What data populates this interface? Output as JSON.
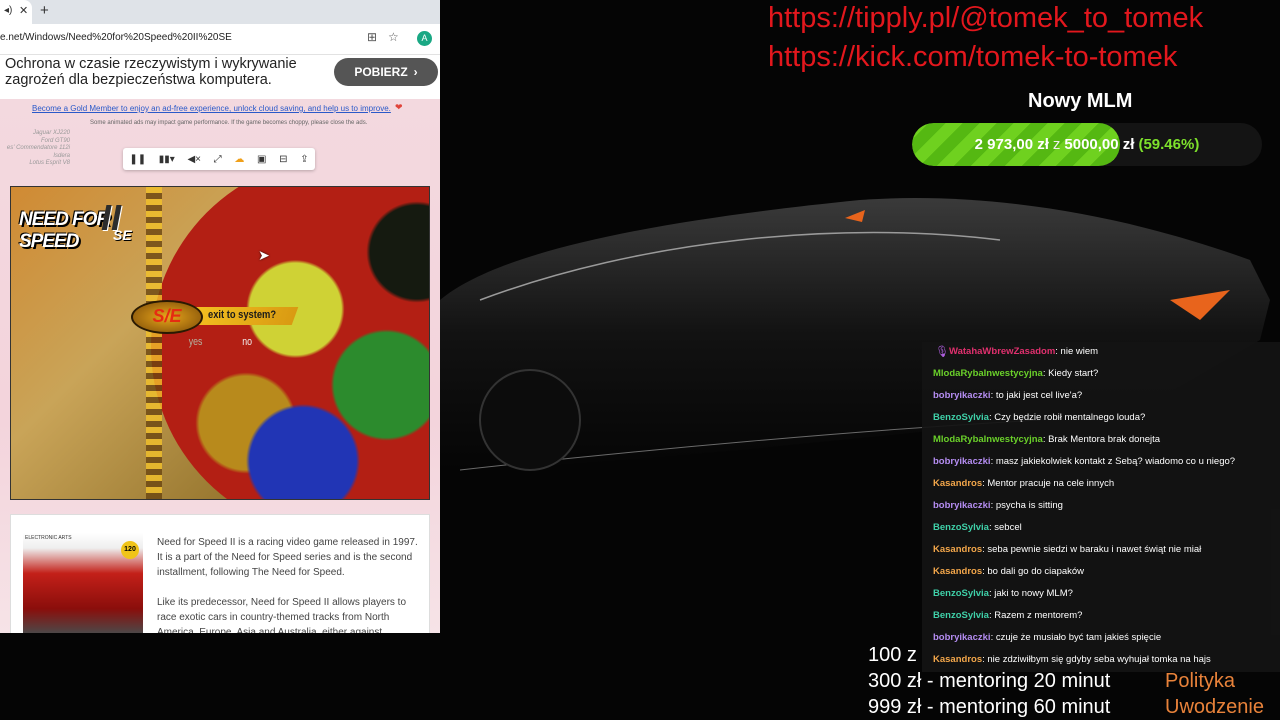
{
  "browser": {
    "url": "e.net/Windows/Need%20for%20Speed%20II%20SE",
    "account_initial": "A",
    "ad": {
      "text": "Ochrona w czasie rzeczywistym i wykrywanie zagrożeń dla bezpieczeństwa komputera.",
      "button": "POBIERZ"
    },
    "gold_link": "Become a Gold Member to enjoy an ad-free experience, unlock cloud saving, and help us to improve.",
    "perf_note": "Some animated ads may impact game performance. If the game becomes choppy, please close the ads.",
    "side_list": [
      "Jaguar XJ220",
      "Ford GT90",
      "es' Commendatore 112i",
      "Isdera",
      "Lotus Esprit V8"
    ],
    "game": {
      "logo_text": "NEED FOR SPEED",
      "logo_numeral": "II",
      "logo_suffix": "SE",
      "badge": "S/E",
      "prompt": "exit to system?",
      "option_yes": "yes",
      "option_no": "no"
    },
    "info": {
      "cover_publisher": "ELECTRONIC ARTS",
      "cover_badge": "120",
      "paragraph1": "Need for Speed II is a racing video game released in 1997. It is a part of the Need for Speed series and is the second installment, following The Need for Speed.",
      "paragraph2": "Like its predecessor, Need for Speed II allows players to race exotic cars in country-themed tracks from North America, Europe, Asia and Australia, either against"
    }
  },
  "overlay": {
    "links": [
      "https://tipply.pl/@tomek_to_tomek",
      "https://kick.com/tomek-to-tomek"
    ],
    "goal": {
      "title": "Nowy MLM",
      "current": "2 973,00 zł",
      "separator": "z",
      "target": "5000,00 zł",
      "percent_label": "(59.46%)",
      "progress_fraction": 0.5946
    },
    "chat": [
      {
        "user": "WatahaWbrewZasadom",
        "color": "#e0306e",
        "text": ": nie wiem"
      },
      {
        "user": "MlodaRybaInwestycyjna",
        "color": "#6ad02a",
        "text": ": Kiedy start?"
      },
      {
        "user": "bobryikaczki",
        "color": "#b58df2",
        "text": ": to jaki jest cel live'a?"
      },
      {
        "user": "BenzoSylvia",
        "color": "#3fd0a8",
        "text": ": Czy będzie robił mentalnego louda?"
      },
      {
        "user": "MlodaRybaInwestycyjna",
        "color": "#6ad02a",
        "text": ": Brak Mentora brak donejta"
      },
      {
        "user": "bobryikaczki",
        "color": "#b58df2",
        "text": ": masz jakiekolwiek kontakt z Sebą? wiadomo co u niego?"
      },
      {
        "user": "Kasandros",
        "color": "#f2a64a",
        "text": ": Mentor pracuje na cele innych"
      },
      {
        "user": "bobryikaczki",
        "color": "#b58df2",
        "text": ": psycha is sitting"
      },
      {
        "user": "BenzoSylvia",
        "color": "#3fd0a8",
        "text": ": sebcel"
      },
      {
        "user": "Kasandros",
        "color": "#f2a64a",
        "text": ": seba pewnie siedzi w baraku i nawet świąt nie miał"
      },
      {
        "user": "Kasandros",
        "color": "#f2a64a",
        "text": ": bo dali go do ciapaków"
      },
      {
        "user": "BenzoSylvia",
        "color": "#3fd0a8",
        "text": ": jaki to nowy MLM?"
      },
      {
        "user": "BenzoSylvia",
        "color": "#3fd0a8",
        "text": ": Razem z mentorem?"
      },
      {
        "user": "bobryikaczki",
        "color": "#b58df2",
        "text": ": czuje że musiało być tam jakieś spięcie"
      },
      {
        "user": "Kasandros",
        "color": "#f2a64a",
        "text": ": nie zdziwiłbym się gdyby seba wyhujał tomka na hajs"
      }
    ],
    "prices": [
      "100 z",
      "300 zł - mentoring 20 minut",
      "999 zł - mentoring 60 minut"
    ],
    "orange_labels": [
      "Polityka",
      "Uwodzenie"
    ]
  }
}
